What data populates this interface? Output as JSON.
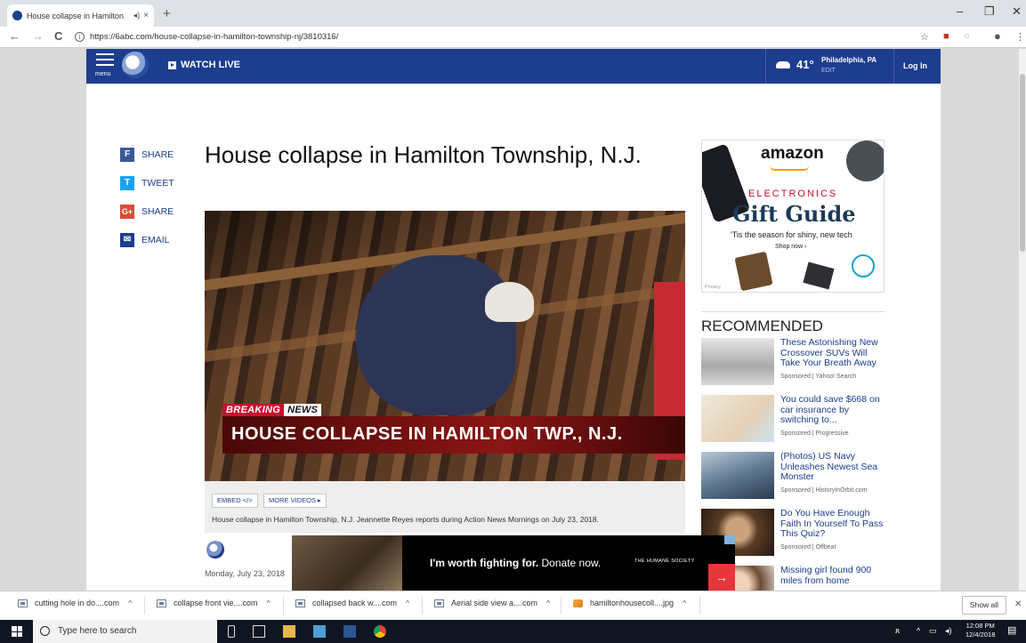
{
  "browser": {
    "tab_title": "House collapse in Hamilton",
    "tab_close": "×",
    "new_tab": "+",
    "win_minimize": "–",
    "win_restore": "❐",
    "win_close": "✕",
    "nav_back": "←",
    "nav_forward": "→",
    "nav_reload": "C",
    "url": "https://6abc.com/house-collapse-in-hamilton-township-nj/3810316/"
  },
  "site": {
    "menu_label": "menu",
    "watch_live": "WATCH LIVE",
    "weather_temp": "41°",
    "weather_city": "Philadelphia, PA",
    "weather_edit": "EDIT",
    "login": "Log In"
  },
  "share": [
    {
      "label": "SHARE",
      "icon": "facebook-icon",
      "glyph": "f",
      "color": "#3b5998"
    },
    {
      "label": "TWEET",
      "icon": "twitter-icon",
      "glyph": "t",
      "color": "#1da1f2"
    },
    {
      "label": "SHARE",
      "icon": "google-plus-icon",
      "glyph": "G+",
      "color": "#dd4b39"
    },
    {
      "label": "EMAIL",
      "icon": "email-icon",
      "glyph": "✉",
      "color": "#1d3d8f"
    }
  ],
  "article": {
    "headline": "House collapse in Hamilton Township, N.J.",
    "breaking": "BREAKING",
    "news": "NEWS",
    "lower_third": "HOUSE COLLAPSE IN HAMILTON TWP., N.J.",
    "embed_btn": "EMBED </>",
    "more_videos_btn": "MORE VIDEOS ▸",
    "caption": "House collapse in Hamilton Township, N.J. Jeannette Reyes reports during Action News Mornings on July 23, 2018.",
    "date": "Monday, July 23, 2018"
  },
  "ad_amazon": {
    "brand": "amazon",
    "section": "ELECTRONICS",
    "headline": "Gift Guide",
    "tagline": "'Tis the season for shiny, new tech",
    "cta": "Shop now ›",
    "privacy": "Privacy"
  },
  "recommended": {
    "title": "RECOMMENDED",
    "items": [
      {
        "title": "These Astonishing New Crossover SUVs Will Take Your Breath Away",
        "sponsor": "Sponsored | Yahoo! Search"
      },
      {
        "title": "You could save $668 on car insurance by switching to...",
        "sponsor": "Sponsored | Progressive"
      },
      {
        "title": "(Photos) US Navy Unleashes Newest Sea Monster",
        "sponsor": "Sponsored | HistoryInOrbit.com"
      },
      {
        "title": "Do You Have Enough Faith In Yourself To Pass This Quiz?",
        "sponsor": "Sponsored | Offbeat"
      },
      {
        "title": "Missing girl found 900 miles from home",
        "sponsor": ""
      }
    ]
  },
  "ad_donate": {
    "bold": "I'm worth fighting for.",
    "rest": " Donate now.",
    "org": "THE HUMANE SOCIETY",
    "arrow": "→"
  },
  "downloads": {
    "items": [
      {
        "name": "cutting hole in do....com",
        "caret": "^"
      },
      {
        "name": "collapse front vie....com",
        "caret": "^"
      },
      {
        "name": "collapsed back w....com",
        "caret": "^"
      },
      {
        "name": "Aerial side view a....com",
        "caret": "^"
      },
      {
        "name": "hamiltonhousecoll....jpg",
        "caret": "^"
      }
    ],
    "show_all": "Show all",
    "close": "✕"
  },
  "taskbar": {
    "search_placeholder": "Type here to search",
    "time": "12:08 PM",
    "date": "12/4/2018"
  }
}
